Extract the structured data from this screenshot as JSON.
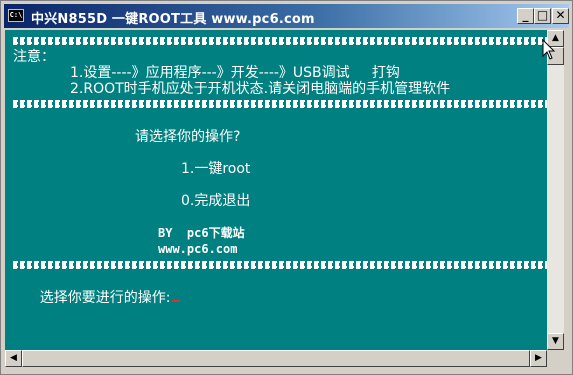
{
  "window": {
    "icon_text": "C:\\",
    "title": "中兴N855D  一键ROOT工具  www.pc6.com",
    "minimize_glyph": "_",
    "maximize_glyph": "□",
    "close_glyph": "✕"
  },
  "console": {
    "separator_char": "=",
    "notice_label": "注意：",
    "notice_1": "1.设置----》应用程序---》开发----》USB调试     打钩",
    "notice_2": "2.ROOT时手机应处于开机状态.请关闭电脑端的手机管理软件",
    "prompt_title": "请选择你的操作?",
    "option_1": "1.一键root",
    "option_0": "0.完成退出",
    "credit_by": "BY  pc6下载站",
    "credit_url": "www.pc6.com",
    "input_prompt": "选择你要进行的操作:"
  },
  "scrollbars": {
    "up_glyph": "▲",
    "down_glyph": "▼",
    "left_glyph": "◀",
    "right_glyph": "▶"
  }
}
